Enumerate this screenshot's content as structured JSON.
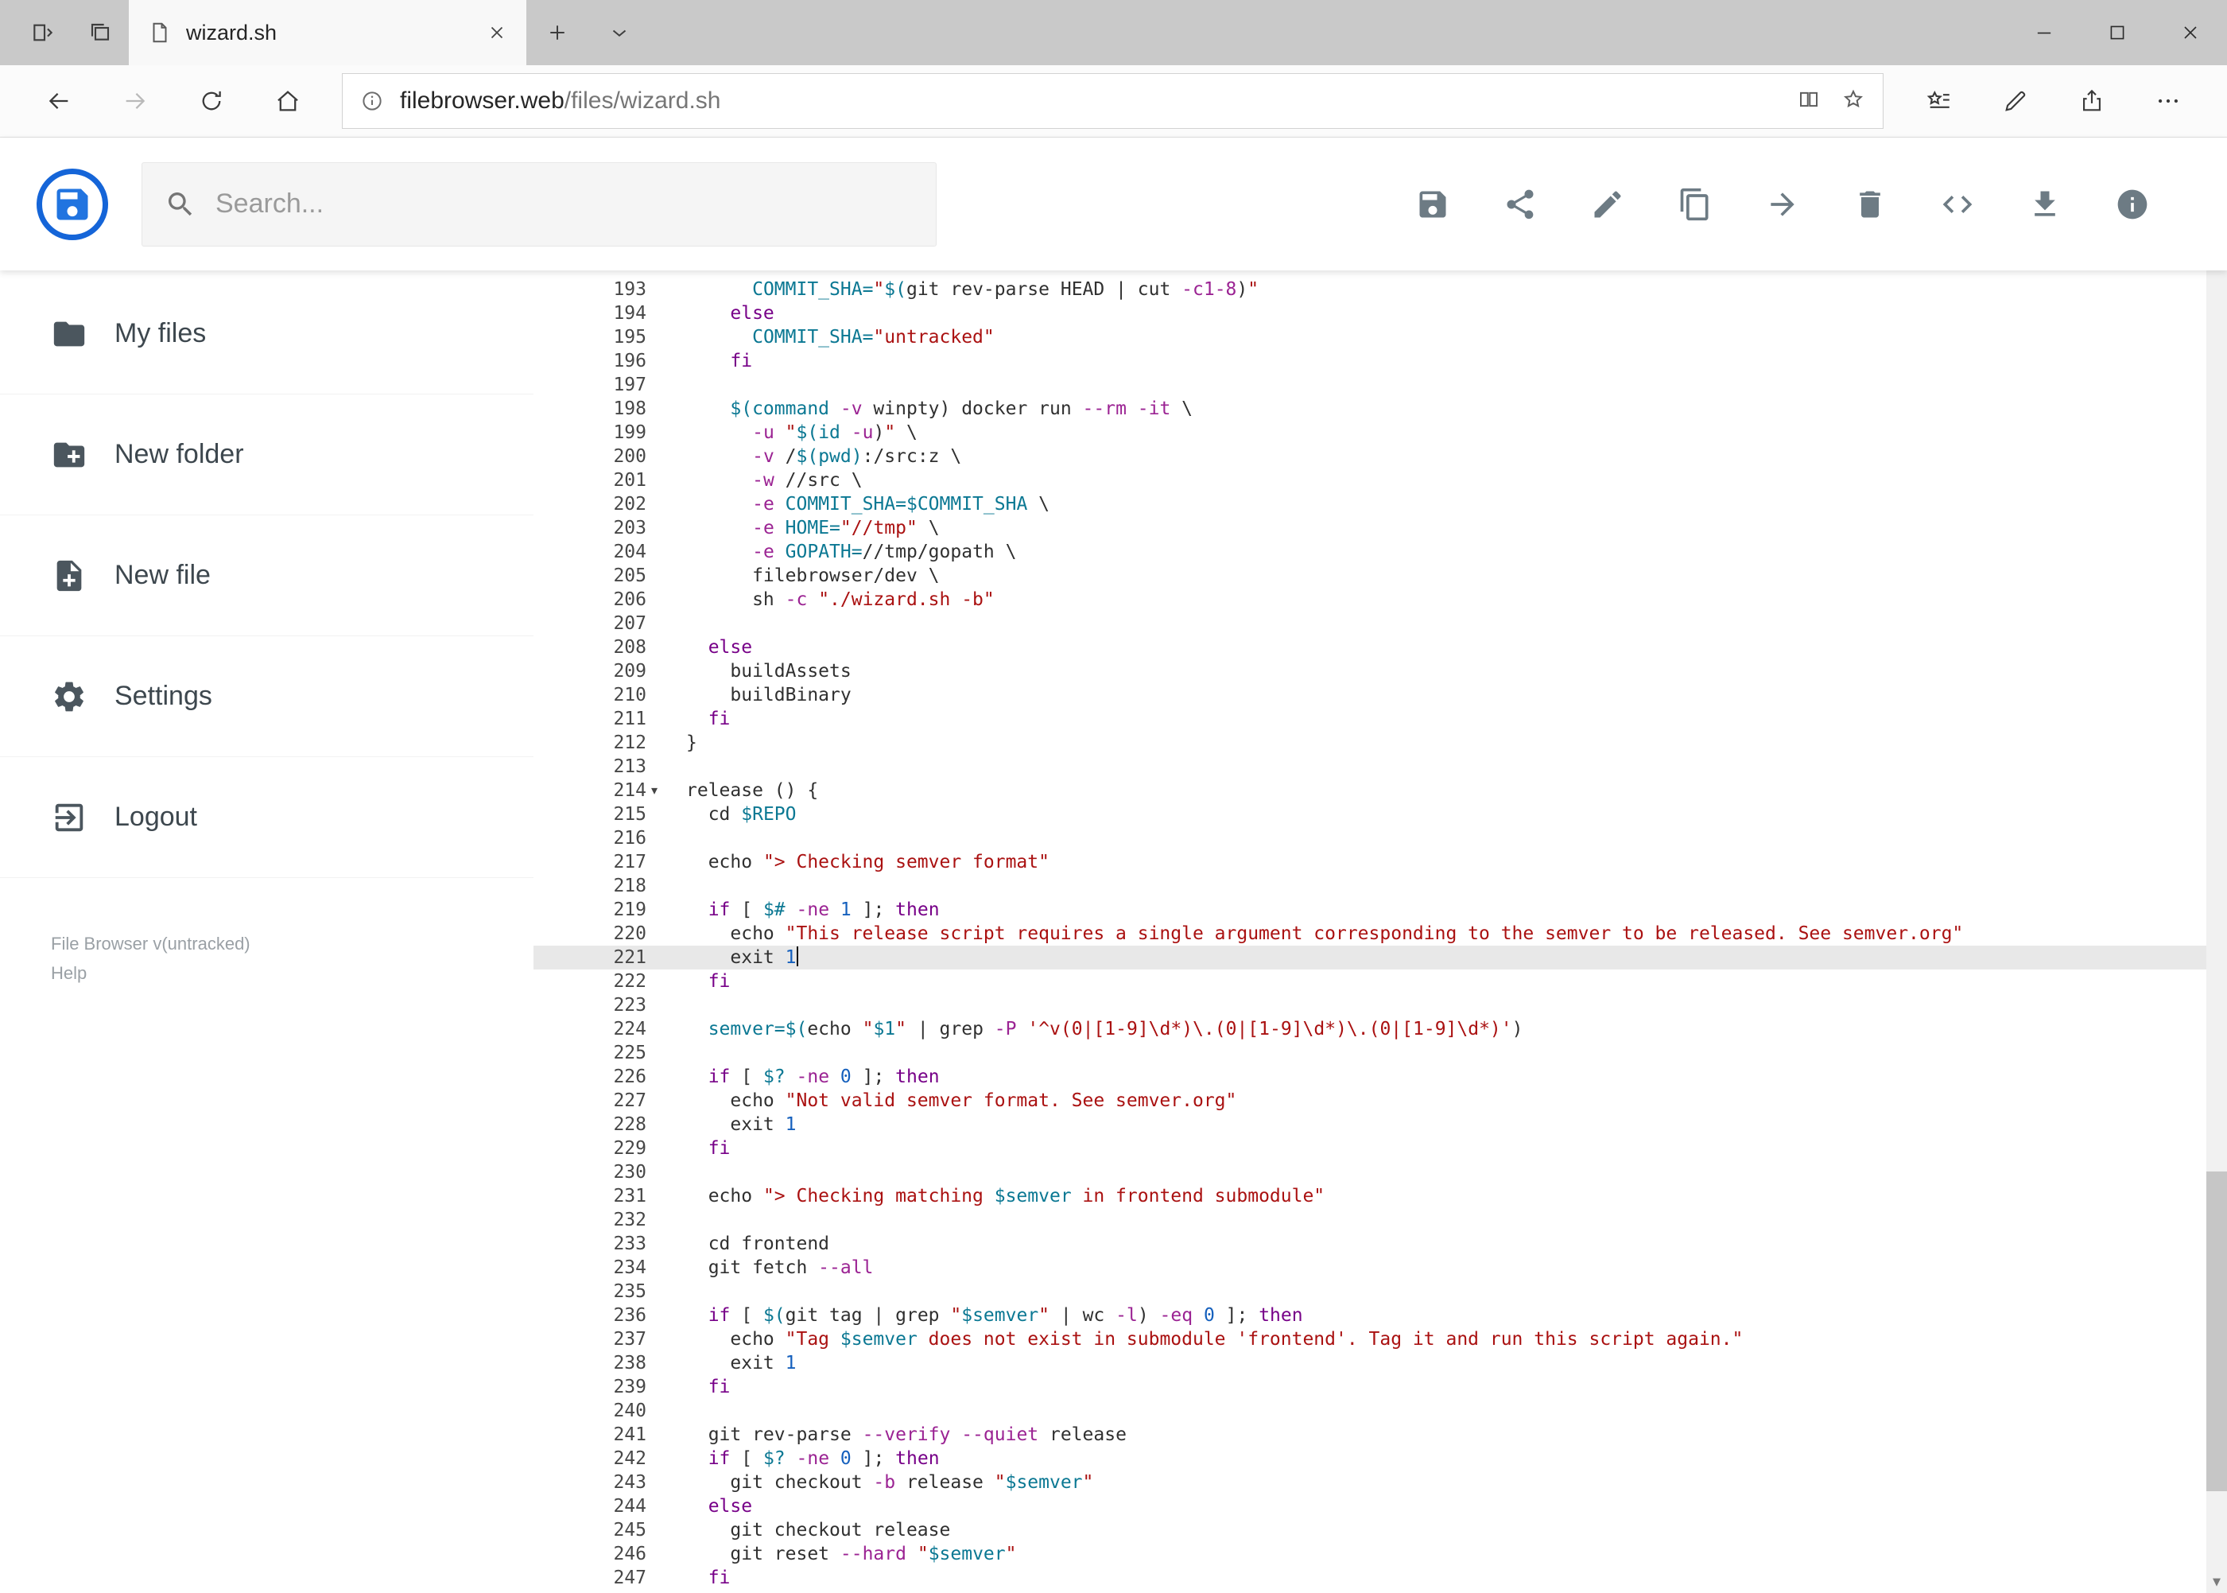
{
  "browser": {
    "tab": {
      "title": "wizard.sh"
    },
    "url": {
      "domain": "filebrowser.web",
      "path": "/files/wizard.sh"
    },
    "tabbar_icons": [
      "set-tabs-aside-icon",
      "tabs-you-set-aside-icon",
      "new-tab-icon",
      "tab-preview-chevron-icon",
      "tab-close-icon",
      "page-icon"
    ],
    "nav_icons": [
      "back-icon",
      "forward-icon",
      "refresh-icon",
      "home-icon"
    ],
    "urlbox_icons": [
      "info-icon",
      "reading-view-icon",
      "favorite-star-icon"
    ],
    "hub_icons": [
      "favorites-hub-icon",
      "web-note-icon",
      "share-page-icon",
      "more-options-icon"
    ],
    "window_controls": [
      "minimize-icon",
      "maximize-icon",
      "window-close-icon"
    ]
  },
  "app_header": {
    "logo_icon": "filebrowser-logo",
    "search_placeholder": "Search...",
    "action_icons": [
      "save-icon",
      "share-icon",
      "edit-icon",
      "copy-icon",
      "move-icon",
      "delete-icon",
      "code-view-icon",
      "download-icon",
      "file-info-icon"
    ]
  },
  "sidebar": {
    "items": [
      {
        "label": "My files",
        "icon": "folder-icon"
      },
      {
        "label": "New folder",
        "icon": "new-folder-icon"
      },
      {
        "label": "New file",
        "icon": "new-file-icon"
      },
      {
        "label": "Settings",
        "icon": "settings-icon"
      },
      {
        "label": "Logout",
        "icon": "logout-icon"
      }
    ],
    "footer": {
      "version": "File Browser v(untracked)",
      "help": "Help"
    }
  },
  "editor": {
    "language": "shell",
    "first_line": 193,
    "last_line": 247,
    "active_line": 221,
    "fold_marker_line": 214,
    "colors": {
      "keyword": "#770088",
      "variable": "#0b7893",
      "string": "#aa1111",
      "flag": "#9b2393",
      "number": "#1560bd",
      "text": "#303030",
      "active_line_bg": "#e8e8e8"
    },
    "lines": [
      {
        "n": 193,
        "t": [
          [
            "p",
            "      "
          ],
          [
            "v",
            "COMMIT_SHA="
          ],
          [
            "s",
            "\""
          ],
          [
            "v",
            "$("
          ],
          [
            "p",
            "git rev-parse HEAD | cut "
          ],
          [
            "o",
            "-c1-8"
          ],
          [
            "p",
            ")"
          ],
          [
            "s",
            "\""
          ]
        ]
      },
      {
        "n": 194,
        "t": [
          [
            "p",
            "    "
          ],
          [
            "k",
            "else"
          ]
        ]
      },
      {
        "n": 195,
        "t": [
          [
            "p",
            "      "
          ],
          [
            "v",
            "COMMIT_SHA="
          ],
          [
            "s",
            "\"untracked\""
          ]
        ]
      },
      {
        "n": 196,
        "t": [
          [
            "p",
            "    "
          ],
          [
            "k",
            "fi"
          ]
        ]
      },
      {
        "n": 197,
        "t": []
      },
      {
        "n": 198,
        "t": [
          [
            "p",
            "    "
          ],
          [
            "v",
            "$(command"
          ],
          [
            "p",
            " "
          ],
          [
            "o",
            "-v"
          ],
          [
            "p",
            " winpty) docker run "
          ],
          [
            "o",
            "--rm"
          ],
          [
            "p",
            " "
          ],
          [
            "o",
            "-it"
          ],
          [
            "p",
            " \\"
          ]
        ]
      },
      {
        "n": 199,
        "t": [
          [
            "p",
            "      "
          ],
          [
            "o",
            "-u"
          ],
          [
            "p",
            " "
          ],
          [
            "s",
            "\""
          ],
          [
            "v",
            "$(id "
          ],
          [
            "o",
            "-u"
          ],
          [
            "p",
            ")"
          ],
          [
            "s",
            "\""
          ],
          [
            "p",
            " \\"
          ]
        ]
      },
      {
        "n": 200,
        "t": [
          [
            "p",
            "      "
          ],
          [
            "o",
            "-v"
          ],
          [
            "p",
            " /"
          ],
          [
            "v",
            "$(pwd)"
          ],
          [
            "p",
            ":/src:z \\"
          ]
        ]
      },
      {
        "n": 201,
        "t": [
          [
            "p",
            "      "
          ],
          [
            "o",
            "-w"
          ],
          [
            "p",
            " //src \\"
          ]
        ]
      },
      {
        "n": 202,
        "t": [
          [
            "p",
            "      "
          ],
          [
            "o",
            "-e"
          ],
          [
            "p",
            " "
          ],
          [
            "v",
            "COMMIT_SHA=$COMMIT_SHA"
          ],
          [
            "p",
            " \\"
          ]
        ]
      },
      {
        "n": 203,
        "t": [
          [
            "p",
            "      "
          ],
          [
            "o",
            "-e"
          ],
          [
            "p",
            " "
          ],
          [
            "v",
            "HOME="
          ],
          [
            "s",
            "\"//tmp\""
          ],
          [
            "p",
            " \\"
          ]
        ]
      },
      {
        "n": 204,
        "t": [
          [
            "p",
            "      "
          ],
          [
            "o",
            "-e"
          ],
          [
            "p",
            " "
          ],
          [
            "v",
            "GOPATH="
          ],
          [
            "p",
            "//tmp/gopath \\"
          ]
        ]
      },
      {
        "n": 205,
        "t": [
          [
            "p",
            "      filebrowser/dev \\"
          ]
        ]
      },
      {
        "n": 206,
        "t": [
          [
            "p",
            "      sh "
          ],
          [
            "o",
            "-c"
          ],
          [
            "p",
            " "
          ],
          [
            "s",
            "\"./wizard.sh -b\""
          ]
        ]
      },
      {
        "n": 207,
        "t": []
      },
      {
        "n": 208,
        "t": [
          [
            "p",
            "  "
          ],
          [
            "k",
            "else"
          ]
        ]
      },
      {
        "n": 209,
        "t": [
          [
            "p",
            "    buildAssets"
          ]
        ]
      },
      {
        "n": 210,
        "t": [
          [
            "p",
            "    buildBinary"
          ]
        ]
      },
      {
        "n": 211,
        "t": [
          [
            "p",
            "  "
          ],
          [
            "k",
            "fi"
          ]
        ]
      },
      {
        "n": 212,
        "t": [
          [
            "p",
            "}"
          ]
        ]
      },
      {
        "n": 213,
        "t": []
      },
      {
        "n": 214,
        "t": [
          [
            "p",
            "release () {"
          ]
        ]
      },
      {
        "n": 215,
        "t": [
          [
            "p",
            "  cd "
          ],
          [
            "v",
            "$REPO"
          ]
        ]
      },
      {
        "n": 216,
        "t": []
      },
      {
        "n": 217,
        "t": [
          [
            "p",
            "  echo "
          ],
          [
            "s",
            "\"> Checking semver format\""
          ]
        ]
      },
      {
        "n": 218,
        "t": []
      },
      {
        "n": 219,
        "t": [
          [
            "p",
            "  "
          ],
          [
            "k",
            "if"
          ],
          [
            "p",
            " [ "
          ],
          [
            "v",
            "$#"
          ],
          [
            "p",
            " "
          ],
          [
            "o",
            "-ne"
          ],
          [
            "p",
            " "
          ],
          [
            "n",
            "1"
          ],
          [
            "p",
            " ]; "
          ],
          [
            "k",
            "then"
          ]
        ]
      },
      {
        "n": 220,
        "t": [
          [
            "p",
            "    echo "
          ],
          [
            "s",
            "\"This release script requires a single argument corresponding to the semver to be released. See semver.org\""
          ]
        ]
      },
      {
        "n": 221,
        "t": [
          [
            "p",
            "    exit "
          ],
          [
            "n",
            "1"
          ]
        ]
      },
      {
        "n": 222,
        "t": [
          [
            "p",
            "  "
          ],
          [
            "k",
            "fi"
          ]
        ]
      },
      {
        "n": 223,
        "t": []
      },
      {
        "n": 224,
        "t": [
          [
            "p",
            "  "
          ],
          [
            "v",
            "semver=$("
          ],
          [
            "p",
            "echo "
          ],
          [
            "s",
            "\""
          ],
          [
            "v",
            "$1"
          ],
          [
            "s",
            "\""
          ],
          [
            "p",
            " | grep "
          ],
          [
            "o",
            "-P"
          ],
          [
            "p",
            " "
          ],
          [
            "s",
            "'^v(0|[1-9]\\d*)\\.(0|[1-9]\\d*)\\.(0|[1-9]\\d*)'"
          ],
          [
            "p",
            ")"
          ]
        ]
      },
      {
        "n": 225,
        "t": []
      },
      {
        "n": 226,
        "t": [
          [
            "p",
            "  "
          ],
          [
            "k",
            "if"
          ],
          [
            "p",
            " [ "
          ],
          [
            "v",
            "$?"
          ],
          [
            "p",
            " "
          ],
          [
            "o",
            "-ne"
          ],
          [
            "p",
            " "
          ],
          [
            "n",
            "0"
          ],
          [
            "p",
            " ]; "
          ],
          [
            "k",
            "then"
          ]
        ]
      },
      {
        "n": 227,
        "t": [
          [
            "p",
            "    echo "
          ],
          [
            "s",
            "\"Not valid semver format. See semver.org\""
          ]
        ]
      },
      {
        "n": 228,
        "t": [
          [
            "p",
            "    exit "
          ],
          [
            "n",
            "1"
          ]
        ]
      },
      {
        "n": 229,
        "t": [
          [
            "p",
            "  "
          ],
          [
            "k",
            "fi"
          ]
        ]
      },
      {
        "n": 230,
        "t": []
      },
      {
        "n": 231,
        "t": [
          [
            "p",
            "  echo "
          ],
          [
            "s",
            "\"> Checking matching "
          ],
          [
            "v",
            "$semver"
          ],
          [
            "s",
            " in frontend submodule\""
          ]
        ]
      },
      {
        "n": 232,
        "t": []
      },
      {
        "n": 233,
        "t": [
          [
            "p",
            "  cd frontend"
          ]
        ]
      },
      {
        "n": 234,
        "t": [
          [
            "p",
            "  git fetch "
          ],
          [
            "o",
            "--all"
          ]
        ]
      },
      {
        "n": 235,
        "t": []
      },
      {
        "n": 236,
        "t": [
          [
            "p",
            "  "
          ],
          [
            "k",
            "if"
          ],
          [
            "p",
            " [ "
          ],
          [
            "v",
            "$("
          ],
          [
            "p",
            "git tag | grep "
          ],
          [
            "s",
            "\""
          ],
          [
            "v",
            "$semver"
          ],
          [
            "s",
            "\""
          ],
          [
            "p",
            " | wc "
          ],
          [
            "o",
            "-l"
          ],
          [
            "p",
            ") "
          ],
          [
            "o",
            "-eq"
          ],
          [
            "p",
            " "
          ],
          [
            "n",
            "0"
          ],
          [
            "p",
            " ]; "
          ],
          [
            "k",
            "then"
          ]
        ]
      },
      {
        "n": 237,
        "t": [
          [
            "p",
            "    echo "
          ],
          [
            "s",
            "\"Tag "
          ],
          [
            "v",
            "$semver"
          ],
          [
            "s",
            " does not exist in submodule 'frontend'. Tag it and run this script again.\""
          ]
        ]
      },
      {
        "n": 238,
        "t": [
          [
            "p",
            "    exit "
          ],
          [
            "n",
            "1"
          ]
        ]
      },
      {
        "n": 239,
        "t": [
          [
            "p",
            "  "
          ],
          [
            "k",
            "fi"
          ]
        ]
      },
      {
        "n": 240,
        "t": []
      },
      {
        "n": 241,
        "t": [
          [
            "p",
            "  git rev-parse "
          ],
          [
            "o",
            "--verify"
          ],
          [
            "p",
            " "
          ],
          [
            "o",
            "--quiet"
          ],
          [
            "p",
            " release"
          ]
        ]
      },
      {
        "n": 242,
        "t": [
          [
            "p",
            "  "
          ],
          [
            "k",
            "if"
          ],
          [
            "p",
            " [ "
          ],
          [
            "v",
            "$?"
          ],
          [
            "p",
            " "
          ],
          [
            "o",
            "-ne"
          ],
          [
            "p",
            " "
          ],
          [
            "n",
            "0"
          ],
          [
            "p",
            " ]; "
          ],
          [
            "k",
            "then"
          ]
        ]
      },
      {
        "n": 243,
        "t": [
          [
            "p",
            "    git checkout "
          ],
          [
            "o",
            "-b"
          ],
          [
            "p",
            " release "
          ],
          [
            "s",
            "\""
          ],
          [
            "v",
            "$semver"
          ],
          [
            "s",
            "\""
          ]
        ]
      },
      {
        "n": 244,
        "t": [
          [
            "p",
            "  "
          ],
          [
            "k",
            "else"
          ]
        ]
      },
      {
        "n": 245,
        "t": [
          [
            "p",
            "    git checkout release"
          ]
        ]
      },
      {
        "n": 246,
        "t": [
          [
            "p",
            "    git reset "
          ],
          [
            "o",
            "--hard"
          ],
          [
            "p",
            " "
          ],
          [
            "s",
            "\""
          ],
          [
            "v",
            "$semver"
          ],
          [
            "s",
            "\""
          ]
        ]
      },
      {
        "n": 247,
        "t": [
          [
            "p",
            "  "
          ],
          [
            "k",
            "fi"
          ]
        ]
      }
    ]
  }
}
